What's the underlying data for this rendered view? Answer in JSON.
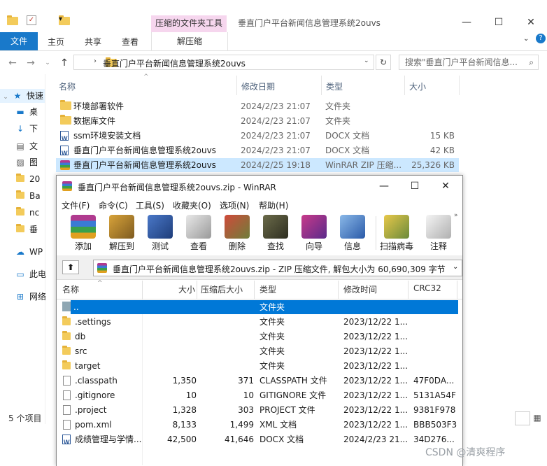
{
  "explorer": {
    "window_title": "垂直门户平台新闻信息管理系统2ouvs",
    "context_tab": "压缩的文件夹工具",
    "ribbon": {
      "file": "文件",
      "home": "主页",
      "share": "共享",
      "view": "查看",
      "manage": "解压缩"
    },
    "address": "垂直门户平台新闻信息管理系统2ouvs",
    "search_placeholder": "搜索\"垂直门户平台新闻信息...",
    "columns": {
      "name": "名称",
      "date": "修改日期",
      "type": "类型",
      "size": "大小"
    },
    "files": [
      {
        "name": "环境部署软件",
        "date": "2024/2/23 21:07",
        "type": "文件夹",
        "size": "",
        "icon": "folder-icon"
      },
      {
        "name": "数据库文件",
        "date": "2024/2/23 21:07",
        "type": "文件夹",
        "size": "",
        "icon": "folder-icon"
      },
      {
        "name": "ssm环境安装文档",
        "date": "2024/2/23 21:07",
        "type": "DOCX 文档",
        "size": "15 KB",
        "icon": "word-doc-icon"
      },
      {
        "name": "垂直门户平台新闻信息管理系统2ouvs",
        "date": "2024/2/23 21:07",
        "type": "DOCX 文档",
        "size": "42 KB",
        "icon": "word-doc-icon"
      },
      {
        "name": "垂直门户平台新闻信息管理系统2ouvs",
        "date": "2024/2/25 19:18",
        "type": "WinRAR ZIP 压缩...",
        "size": "25,326 KB",
        "icon": "rar-archive-icon"
      }
    ],
    "nav": [
      {
        "label": "快速",
        "icon": "star-icon"
      },
      {
        "label": "桌",
        "icon": "desktop-icon"
      },
      {
        "label": "下",
        "icon": "download-icon"
      },
      {
        "label": "文",
        "icon": "document-icon"
      },
      {
        "label": "图",
        "icon": "picture-icon"
      },
      {
        "label": "20",
        "icon": "folder-icon"
      },
      {
        "label": "Ba",
        "icon": "folder-icon"
      },
      {
        "label": "nc",
        "icon": "folder-icon"
      },
      {
        "label": "垂",
        "icon": "folder-icon"
      },
      {
        "label": "WP",
        "icon": "cloud-icon"
      },
      {
        "label": "此电",
        "icon": "computer-icon"
      },
      {
        "label": "网络",
        "icon": "network-icon"
      }
    ],
    "status": "5 个项目"
  },
  "winrar": {
    "title": "垂直门户平台新闻信息管理系统2ouvs.zip - WinRAR",
    "menu": [
      "文件(F)",
      "命令(C)",
      "工具(S)",
      "收藏夹(O)",
      "选项(N)",
      "帮助(H)"
    ],
    "toolbar": [
      "添加",
      "解压到",
      "测试",
      "查看",
      "删除",
      "查找",
      "向导",
      "信息",
      "扫描病毒",
      "注释"
    ],
    "path": "垂直门户平台新闻信息管理系统2ouvs.zip - ZIP 压缩文件, 解包大小为 60,690,309 字节",
    "columns": {
      "name": "名称",
      "size": "大小",
      "packed": "压缩后大小",
      "type": "类型",
      "modified": "修改时间",
      "crc": "CRC32"
    },
    "entries": [
      {
        "name": "..",
        "size": "",
        "packed": "",
        "type": "文件夹",
        "modified": "",
        "crc": "",
        "icon": "parent-folder-icon"
      },
      {
        "name": ".settings",
        "size": "",
        "packed": "",
        "type": "文件夹",
        "modified": "2023/12/22 1...",
        "crc": "",
        "icon": "folder-icon"
      },
      {
        "name": "db",
        "size": "",
        "packed": "",
        "type": "文件夹",
        "modified": "2023/12/22 1...",
        "crc": "",
        "icon": "folder-icon"
      },
      {
        "name": "src",
        "size": "",
        "packed": "",
        "type": "文件夹",
        "modified": "2023/12/22 1...",
        "crc": "",
        "icon": "folder-icon"
      },
      {
        "name": "target",
        "size": "",
        "packed": "",
        "type": "文件夹",
        "modified": "2023/12/22 1...",
        "crc": "",
        "icon": "folder-icon"
      },
      {
        "name": ".classpath",
        "size": "1,350",
        "packed": "371",
        "type": "CLASSPATH 文件",
        "modified": "2023/12/22 1...",
        "crc": "47F0DA...",
        "icon": "file-icon"
      },
      {
        "name": ".gitignore",
        "size": "10",
        "packed": "10",
        "type": "GITIGNORE 文件",
        "modified": "2023/12/22 1...",
        "crc": "5131A54F",
        "icon": "file-icon"
      },
      {
        "name": ".project",
        "size": "1,328",
        "packed": "303",
        "type": "PROJECT 文件",
        "modified": "2023/12/22 1...",
        "crc": "9381F978",
        "icon": "file-icon"
      },
      {
        "name": "pom.xml",
        "size": "8,133",
        "packed": "1,499",
        "type": "XML 文档",
        "modified": "2023/12/22 1...",
        "crc": "BBB503F3",
        "icon": "file-icon"
      },
      {
        "name": "成绩管理与学情...",
        "size": "42,500",
        "packed": "41,646",
        "type": "DOCX 文档",
        "modified": "2024/2/23 21...",
        "crc": "34D276...",
        "icon": "word-doc-icon"
      }
    ]
  },
  "watermark": "CSDN @清爽程序"
}
